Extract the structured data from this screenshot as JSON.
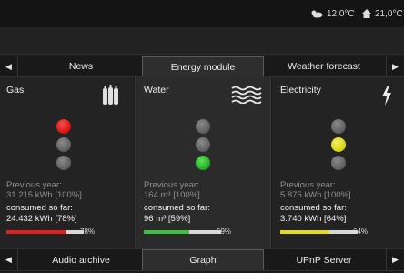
{
  "status": {
    "outdoor_temp": "12,0°C",
    "indoor_temp": "21,0°C"
  },
  "tabs_top": [
    {
      "label": "News",
      "active": false
    },
    {
      "label": "Energy module",
      "active": true
    },
    {
      "label": "Weather forecast",
      "active": false
    }
  ],
  "tabs_bottom": [
    {
      "label": "Audio archive",
      "active": false
    },
    {
      "label": "Graph",
      "active": true
    },
    {
      "label": "UPnP Server",
      "active": false
    }
  ],
  "panels": [
    {
      "title": "Gas",
      "icon": "gas-cylinders-icon",
      "light_active": "red",
      "prev_label": "Previous year:",
      "prev_value": "31.215 kWh [100%]",
      "cur_label": "consumed so far:",
      "cur_value": "24.432 kWh [78%]",
      "bar_percent": 0.78,
      "bar_color": "#e02020",
      "bar_label": "78%"
    },
    {
      "title": "Water",
      "icon": "water-waves-icon",
      "light_active": "green",
      "prev_label": "Previous year:",
      "prev_value": "164 m³ [100%]",
      "cur_label": "consumed so far:",
      "cur_value": "96 m³ [59%]",
      "bar_percent": 0.59,
      "bar_color": "#3fbf3f",
      "bar_label": "59%"
    },
    {
      "title": "Electricity",
      "icon": "lightning-bolt-icon",
      "light_active": "yellow",
      "prev_label": "Previous year:",
      "prev_value": "5.875 kWh [100%]",
      "cur_label": "consumed so far:",
      "cur_value": "3.740 kWh [64%]",
      "bar_percent": 0.64,
      "bar_color": "#e4dc1a",
      "bar_label": "64%"
    }
  ]
}
